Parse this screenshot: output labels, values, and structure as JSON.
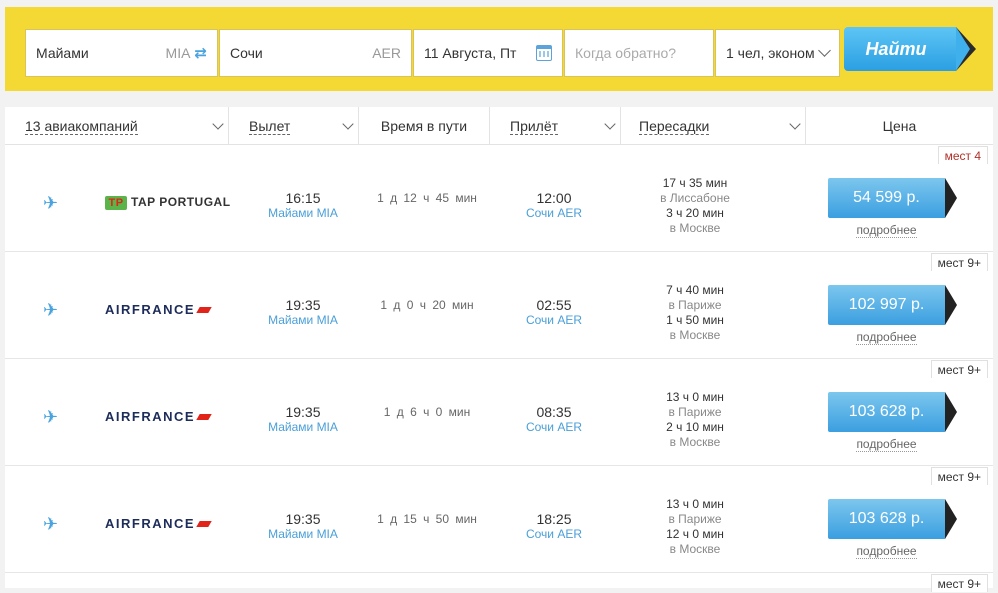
{
  "search": {
    "from": {
      "city": "Майами",
      "code": "MIA"
    },
    "to": {
      "city": "Сочи",
      "code": "AER"
    },
    "date": "11 Августа, Пт",
    "return_placeholder": "Когда обратно?",
    "passengers": "1 чел, эконом",
    "find_label": "Найти"
  },
  "filters": {
    "airlines": "13 авиакомпаний",
    "departure": "Вылет",
    "duration": "Время в пути",
    "arrival": "Прилёт",
    "stops": "Пересадки",
    "price": "Цена"
  },
  "flights": [
    {
      "airline": "TAP PORTUGAL",
      "dep_time": "16:15",
      "dep_city": "Майами MIA",
      "duration": "1 д 12 ч 45 мин",
      "arr_time": "12:00",
      "arr_city": "Сочи AER",
      "stop1_time": "17 ч 35 мин",
      "stop1_place": "в Лиссабоне",
      "stop2_time": "3 ч 20 мин",
      "stop2_place": "в Москве",
      "seats": "мест 4",
      "price": "54 599 р.",
      "details": "подробнее"
    },
    {
      "airline": "AIRFRANCE",
      "dep_time": "19:35",
      "dep_city": "Майами MIA",
      "duration": "1 д 0 ч 20 мин",
      "arr_time": "02:55",
      "arr_city": "Сочи AER",
      "stop1_time": "7 ч 40 мин",
      "stop1_place": "в Париже",
      "stop2_time": "1 ч 50 мин",
      "stop2_place": "в Москве",
      "seats": "мест 9+",
      "price": "102 997 р.",
      "details": "подробнее"
    },
    {
      "airline": "AIRFRANCE",
      "dep_time": "19:35",
      "dep_city": "Майами MIA",
      "duration": "1 д 6 ч 0 мин",
      "arr_time": "08:35",
      "arr_city": "Сочи AER",
      "stop1_time": "13 ч 0 мин",
      "stop1_place": "в Париже",
      "stop2_time": "2 ч 10 мин",
      "stop2_place": "в Москве",
      "seats": "мест 9+",
      "price": "103 628 р.",
      "details": "подробнее"
    },
    {
      "airline": "AIRFRANCE",
      "dep_time": "19:35",
      "dep_city": "Майами MIA",
      "duration": "1 д 15 ч 50 мин",
      "arr_time": "18:25",
      "arr_city": "Сочи AER",
      "stop1_time": "13 ч 0 мин",
      "stop1_place": "в Париже",
      "stop2_time": "12 ч 0 мин",
      "stop2_place": "в Москве",
      "seats": "мест 9+",
      "price": "103 628 р.",
      "details": "подробнее"
    }
  ],
  "next_seats": "мест 9+",
  "colors": {
    "accent_yellow": "#f4d934",
    "accent_blue": "#3b9fe0",
    "link_blue": "#4a9fd8"
  }
}
